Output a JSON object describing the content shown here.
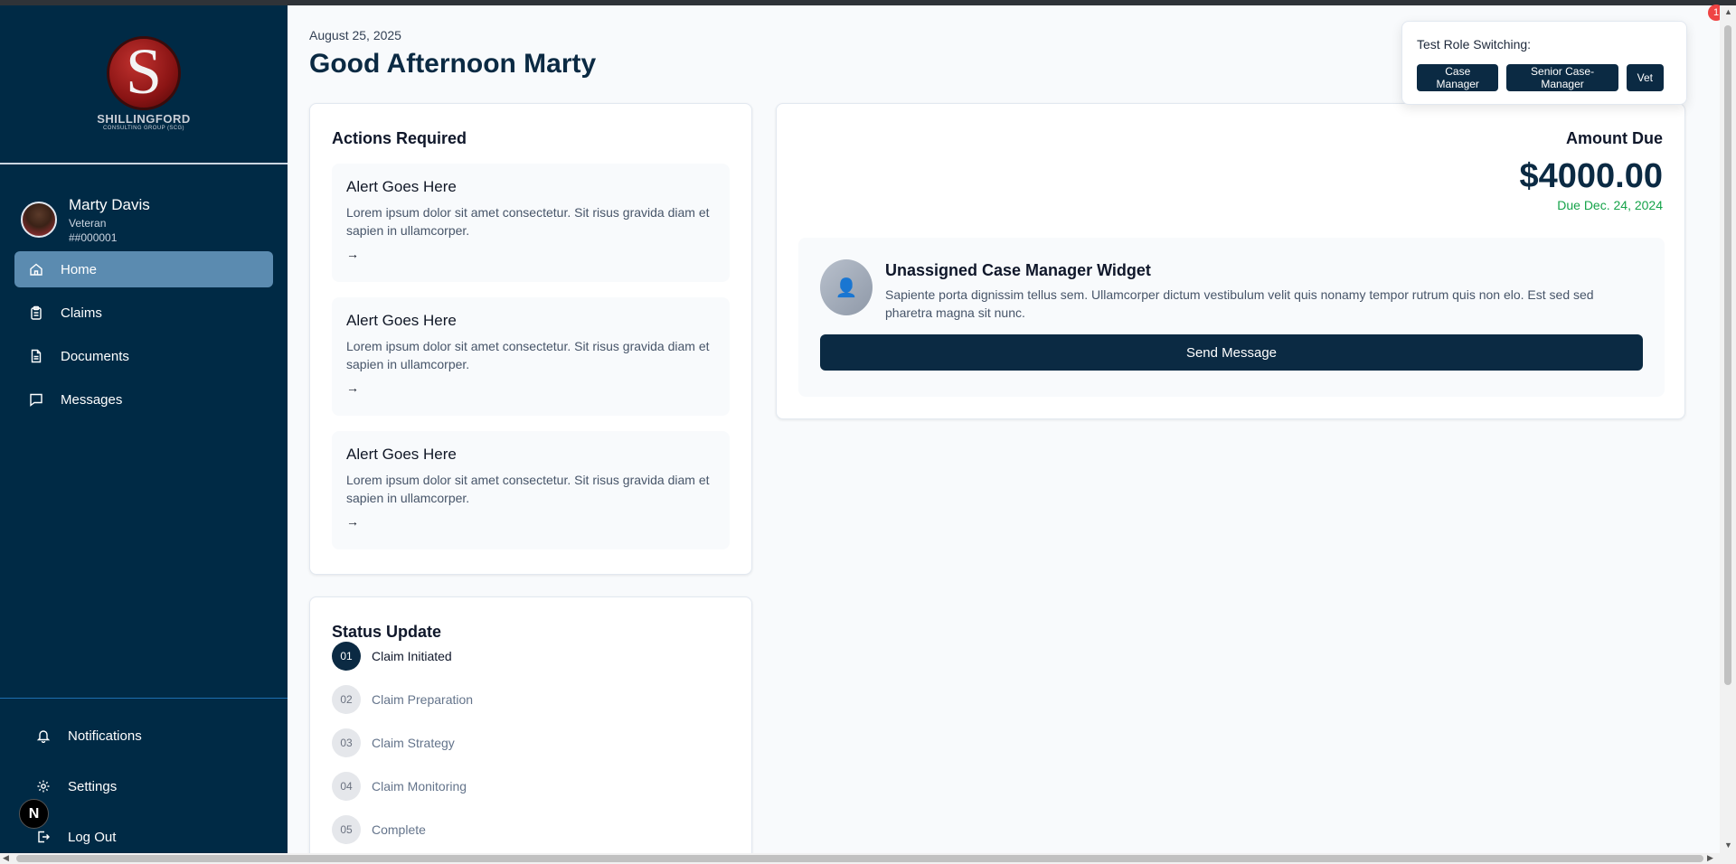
{
  "sidebar": {
    "logo": {
      "letter": "S",
      "name": "SHILLINGFORD",
      "sub": "CONSULTING GROUP (SCG)"
    },
    "profile": {
      "name": "Marty Davis",
      "role": "Veteran",
      "id": "##000001"
    },
    "nav": [
      {
        "label": "Home",
        "icon": "home-icon",
        "active": true
      },
      {
        "label": "Claims",
        "icon": "clipboard-icon",
        "active": false
      },
      {
        "label": "Documents",
        "icon": "document-icon",
        "active": false
      },
      {
        "label": "Messages",
        "icon": "message-icon",
        "active": false
      }
    ],
    "bottom": [
      {
        "label": "Notifications",
        "icon": "bell-icon"
      },
      {
        "label": "Settings",
        "icon": "gear-icon"
      },
      {
        "label": "Log Out",
        "icon": "logout-icon"
      }
    ],
    "badge_letter": "N"
  },
  "header": {
    "date": "August 25, 2025",
    "greeting": "Good Afternoon Marty"
  },
  "actions": {
    "title": "Actions Required",
    "alerts": [
      {
        "title": "Alert Goes Here",
        "body": "Lorem ipsum dolor sit amet consectetur. Sit risus gravida diam et sapien in ullamcorper.",
        "arrow": "→"
      },
      {
        "title": "Alert Goes Here",
        "body": "Lorem ipsum dolor sit amet consectetur. Sit risus gravida diam et sapien in ullamcorper.",
        "arrow": "→"
      },
      {
        "title": "Alert Goes Here",
        "body": "Lorem ipsum dolor sit amet consectetur. Sit risus gravida diam et sapien in ullamcorper.",
        "arrow": "→"
      }
    ]
  },
  "status": {
    "title": "Status Update",
    "steps": [
      {
        "num": "01",
        "label": "Claim Initiated",
        "active": true
      },
      {
        "num": "02",
        "label": "Claim Preparation",
        "active": false
      },
      {
        "num": "03",
        "label": "Claim Strategy",
        "active": false
      },
      {
        "num": "04",
        "label": "Claim Monitoring",
        "active": false
      },
      {
        "num": "05",
        "label": "Complete",
        "active": false
      }
    ]
  },
  "amount": {
    "title": "Amount Due",
    "value": "$4000.00",
    "due": "Due Dec. 24, 2024"
  },
  "widget": {
    "avatar_icon": "👤",
    "title": "Unassigned Case Manager Widget",
    "body": "Sapiente porta dignissim tellus sem. Ullamcorper dictum vestibulum velit quis nonamy tempor rutrum quis non elo. Est sed sed pharetra magna sit nunc.",
    "button": "Send Message"
  },
  "role_switch": {
    "title": "Test Role Switching:",
    "buttons": [
      "Case Manager",
      "Senior Case-Manager",
      "Vet"
    ]
  },
  "notification_count": "1",
  "colors": {
    "sidebar_bg": "#002a45",
    "accent": "#0b2a43",
    "active_nav": "#5b8bb0",
    "due_green": "#16a34a",
    "badge_red": "#ef4444"
  }
}
